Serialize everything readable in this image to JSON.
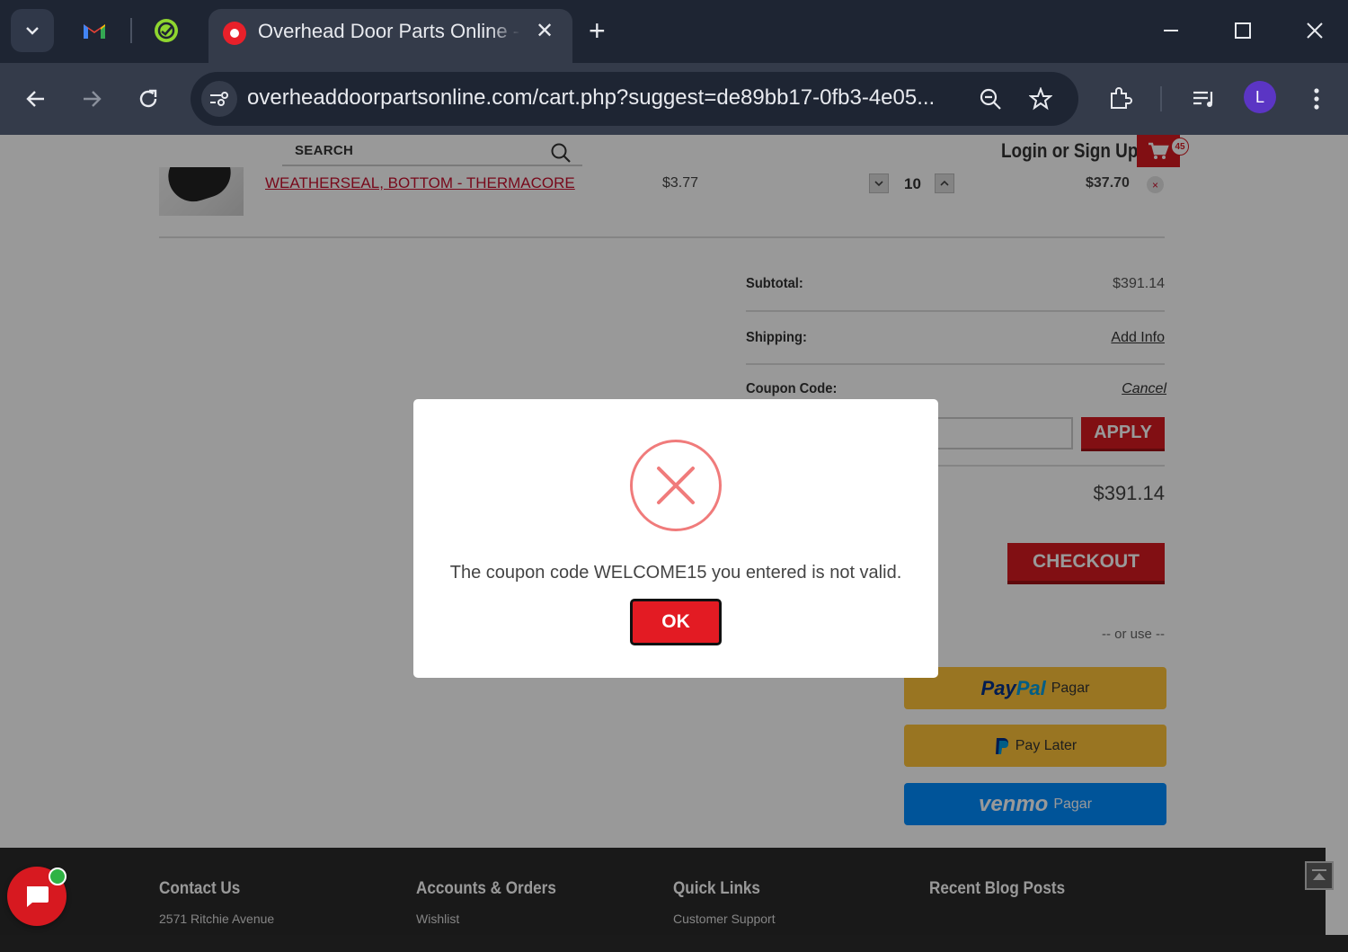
{
  "browser": {
    "tab": {
      "title": "Overhead Door Parts Online - S",
      "close_glyph": "✕"
    },
    "new_tab_glyph": "+",
    "url": "overheaddoorpartsonline.com/cart.php?suggest=de89bb17-0fb3-4e05...",
    "profile_initial": "L"
  },
  "header": {
    "search_label": "SEARCH",
    "login_label": "Login or Sign Up",
    "cart_count": "45"
  },
  "cart": {
    "item": {
      "name": "WEATHERSEAL, BOTTOM - THERMACORE",
      "unit_price": "$3.77",
      "quantity": "10",
      "line_total": "$37.70",
      "remove_glyph": "×"
    },
    "totals": {
      "subtotal_label": "Subtotal:",
      "subtotal_value": "$391.14",
      "shipping_label": "Shipping:",
      "shipping_link": "Add Info",
      "coupon_label": "Coupon Code:",
      "coupon_cancel": "Cancel",
      "apply_label": "APPLY",
      "grand_total": "$391.14"
    },
    "checkout_label": "CHECKOUT",
    "or_use": "-- or use --",
    "paypal": {
      "pay": "Pay",
      "pal": "Pal",
      "suffix": "Pagar"
    },
    "paylater": {
      "label": "Pay Later"
    },
    "venmo": {
      "logo": "venmo",
      "suffix": "Pagar"
    }
  },
  "footer": {
    "columns": [
      {
        "heading": "Contact Us",
        "first": "2571 Ritchie Avenue"
      },
      {
        "heading": "Accounts & Orders",
        "first": "Wishlist"
      },
      {
        "heading": "Quick Links",
        "first": "Customer Support"
      },
      {
        "heading": "Recent Blog Posts",
        "first": ""
      }
    ]
  },
  "modal": {
    "message": "The coupon code WELCOME15 you entered is not valid.",
    "ok_label": "OK"
  },
  "colors": {
    "brand_red": "#d71920",
    "error_ring": "#f07b7b",
    "paypal_yellow": "#ffc439",
    "venmo_blue": "#008cff"
  },
  "icons": [
    "tab-search-icon",
    "gmail-icon",
    "extension-favicon-icon",
    "back-icon",
    "forward-icon",
    "reload-icon",
    "site-settings-icon",
    "zoom-icon",
    "bookmark-star-icon",
    "extensions-icon",
    "media-icon",
    "menu-dots-icon",
    "search-icon",
    "cart-icon",
    "error-x-icon",
    "chat-icon",
    "scroll-top-icon"
  ]
}
